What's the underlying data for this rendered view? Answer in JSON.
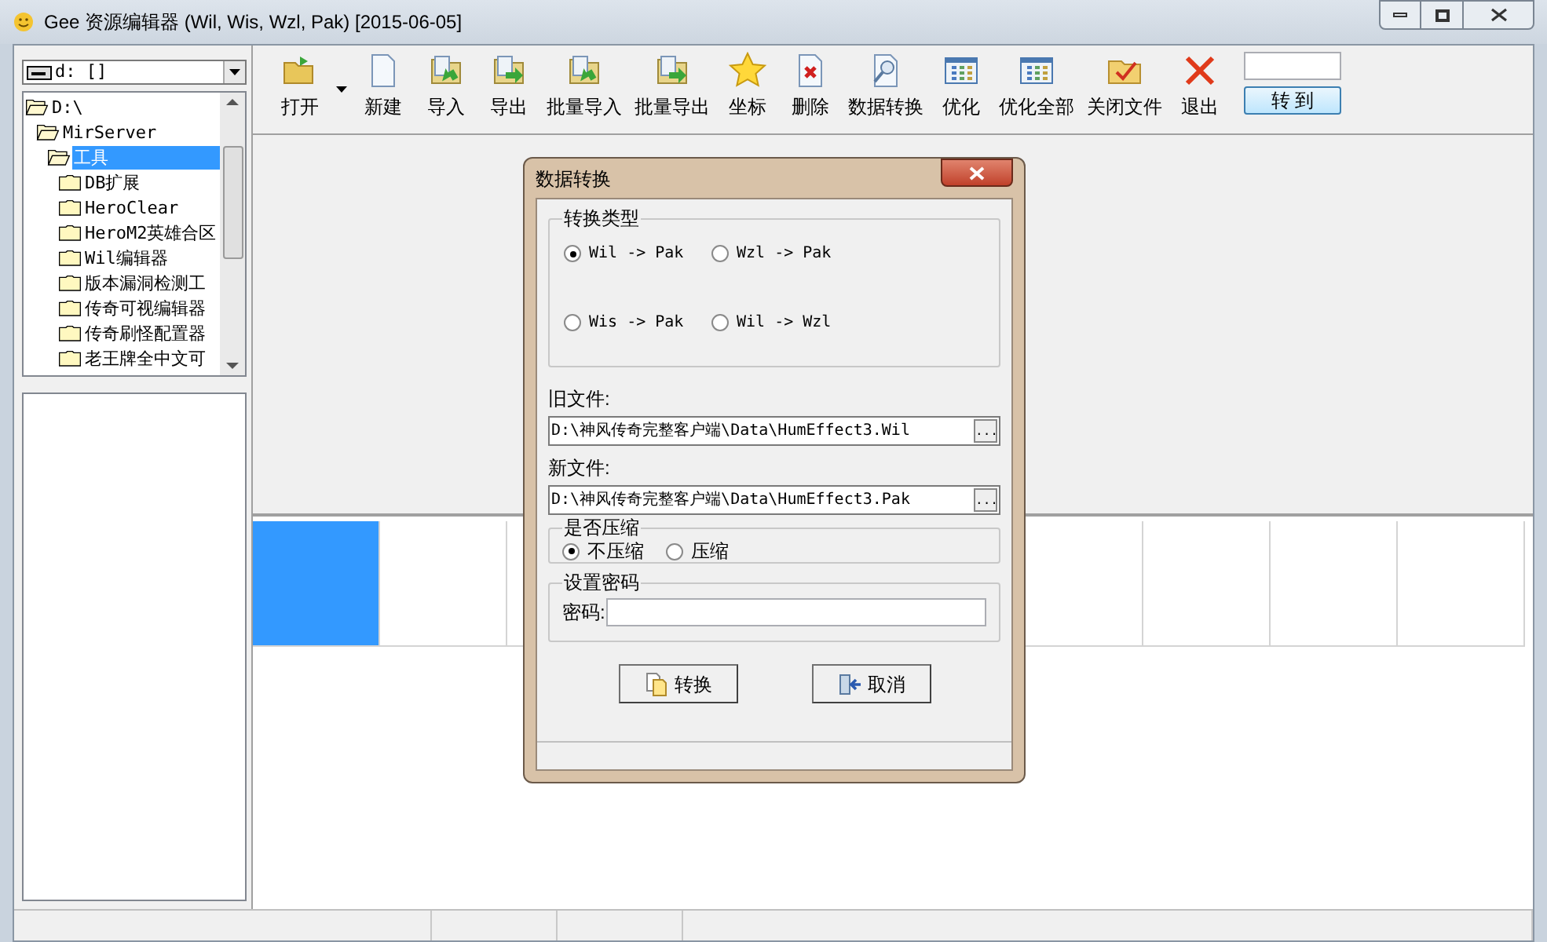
{
  "window": {
    "title": "Gee 资源编辑器 (Wil, Wis, Wzl, Pak) [2015-06-05]"
  },
  "drive_select": {
    "value": "d: []"
  },
  "tree": [
    {
      "label": "D:\\",
      "selected": false,
      "expanded": true,
      "children": [
        {
          "label": "MirServer",
          "selected": false,
          "expanded": true,
          "children": [
            {
              "label": "工具",
              "selected": true,
              "expanded": true,
              "children": [
                {
                  "label": "DB扩展",
                  "selected": false,
                  "expanded": false
                },
                {
                  "label": "HeroClear",
                  "selected": false,
                  "expanded": false
                },
                {
                  "label": "HeroM2英雄合区",
                  "selected": false,
                  "expanded": false
                },
                {
                  "label": "Wil编辑器",
                  "selected": false,
                  "expanded": false
                },
                {
                  "label": "版本漏洞检测工",
                  "selected": false,
                  "expanded": false
                },
                {
                  "label": "传奇可视编辑器",
                  "selected": false,
                  "expanded": false
                },
                {
                  "label": "传奇刷怪配置器",
                  "selected": false,
                  "expanded": false
                },
                {
                  "label": "老王牌全中文可",
                  "selected": false,
                  "expanded": false
                }
              ]
            }
          ]
        }
      ]
    }
  ],
  "toolbar": [
    {
      "kind": "open",
      "label": "打开",
      "dropdown": true
    },
    {
      "kind": "new",
      "label": "新建",
      "dropdown": false
    },
    {
      "kind": "import",
      "label": "导入",
      "dropdown": false
    },
    {
      "kind": "export",
      "label": "导出",
      "dropdown": false
    },
    {
      "kind": "import",
      "label": "批量导入",
      "dropdown": false
    },
    {
      "kind": "export",
      "label": "批量导出",
      "dropdown": false
    },
    {
      "kind": "star",
      "label": "坐标",
      "dropdown": false
    },
    {
      "kind": "delete",
      "label": "删除",
      "dropdown": false
    },
    {
      "kind": "search",
      "label": "数据转换",
      "dropdown": false
    },
    {
      "kind": "grid",
      "label": "优化",
      "dropdown": false
    },
    {
      "kind": "grid",
      "label": "优化全部",
      "dropdown": false
    },
    {
      "kind": "close-file",
      "label": "关闭文件",
      "dropdown": false
    },
    {
      "kind": "exit",
      "label": "退出",
      "dropdown": false
    }
  ],
  "goto": {
    "button": "转 到"
  },
  "grid": {
    "left_cells": [
      {
        "selected": true
      },
      {
        "selected": false
      },
      {
        "selected": false
      }
    ],
    "right_cells": [
      {
        "selected": false
      },
      {
        "selected": false
      },
      {
        "selected": false
      },
      {
        "selected": false
      }
    ]
  },
  "dialog": {
    "title": "数据转换",
    "conversion_type": {
      "legend": "转换类型",
      "options": [
        {
          "label": "Wil -> Pak",
          "selected": true
        },
        {
          "label": "Wzl -> Pak",
          "selected": false
        },
        {
          "label": "Wis -> Pak",
          "selected": false
        },
        {
          "label": "Wil -> Wzl",
          "selected": false
        }
      ]
    },
    "old_file": {
      "label": "旧文件:",
      "value": "D:\\神风传奇完整客户端\\Data\\HumEffect3.Wil",
      "browse": "..."
    },
    "new_file": {
      "label": "新文件:",
      "value": "D:\\神风传奇完整客户端\\Data\\HumEffect3.Pak",
      "browse": "..."
    },
    "compression": {
      "legend": "是否压缩",
      "options": [
        {
          "label": "不压缩",
          "selected": true
        },
        {
          "label": "压缩",
          "selected": false
        }
      ]
    },
    "password": {
      "legend": "设置密码",
      "label": "密码:"
    },
    "buttons": [
      {
        "kind": "convert",
        "label": "转换"
      },
      {
        "kind": "cancel",
        "label": "取消"
      }
    ]
  }
}
